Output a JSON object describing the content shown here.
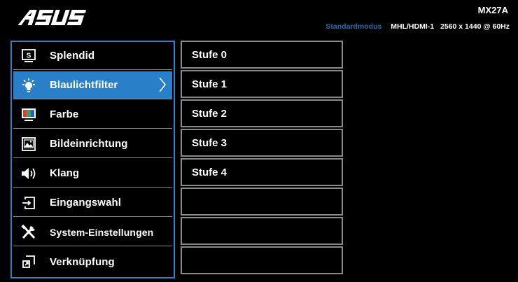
{
  "header": {
    "brand": "ASUS",
    "model": "MX27A",
    "mode": "Standardmodus",
    "input_source": "MHL/HDMI-1",
    "resolution": "2560 x 1440 @ 60Hz"
  },
  "menu": {
    "items": [
      {
        "label": "Splendid",
        "icon": "splendid-icon"
      },
      {
        "label": "Blaulichtfilter",
        "icon": "bluelight-bulb-icon",
        "selected": true
      },
      {
        "label": "Farbe",
        "icon": "color-icon"
      },
      {
        "label": "Bildeinrichtung",
        "icon": "image-icon"
      },
      {
        "label": "Klang",
        "icon": "speaker-icon"
      },
      {
        "label": "Eingangswahl",
        "icon": "input-select-icon"
      },
      {
        "label": "System-Einstellungen",
        "icon": "tools-icon"
      },
      {
        "label": "Verknüpfung",
        "icon": "shortcut-icon"
      }
    ]
  },
  "submenu": {
    "items": [
      "Stufe 0",
      "Stufe 1",
      "Stufe 2",
      "Stufe 3",
      "Stufe 4",
      "",
      "",
      ""
    ]
  },
  "colors": {
    "accent": "#2a7fc9",
    "mode_text": "#1f6fb6",
    "border": "#8a8a8a",
    "background": "#000000"
  }
}
